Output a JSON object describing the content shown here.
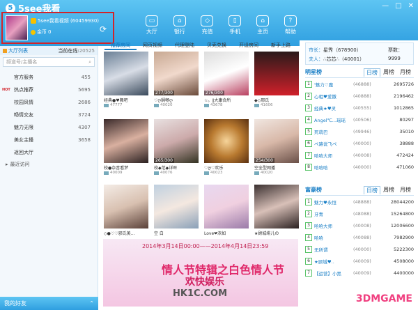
{
  "app": {
    "title": "5see我看"
  },
  "window": {
    "min": "—",
    "max": "□",
    "close": "✕"
  },
  "user": {
    "name": "5see我看视频 (60459930)",
    "coins_label": "金币",
    "coins": "0"
  },
  "nav": [
    {
      "label": "大厅",
      "icon": "hall-icon"
    },
    {
      "label": "银行",
      "icon": "bank-icon"
    },
    {
      "label": "充值",
      "icon": "recharge-icon"
    },
    {
      "label": "手机",
      "icon": "phone-icon"
    },
    {
      "label": "主页",
      "icon": "home-icon"
    },
    {
      "label": "帮助",
      "icon": "help-icon"
    }
  ],
  "sidebar": {
    "list_label": "大厅列表",
    "online_label": "当前在线:",
    "online": "20525",
    "search_placeholder": "频道号/主播名",
    "categories": [
      {
        "label": "官方服务",
        "count": "455",
        "hot": ""
      },
      {
        "label": "热点推荐",
        "count": "5695",
        "hot": "HOT"
      },
      {
        "label": "校园风情",
        "count": "2686",
        "hot": ""
      },
      {
        "label": "畅情交友",
        "count": "3724",
        "hot": ""
      },
      {
        "label": "魅力无限",
        "count": "4307",
        "hot": ""
      },
      {
        "label": "美女主播",
        "count": "3658",
        "hot": ""
      },
      {
        "label": "返回大厅",
        "count": "",
        "hot": ""
      }
    ],
    "recent": "最近访问",
    "friends": "我的好友"
  },
  "tabs": [
    "推荐房间",
    "网页视频",
    "代理登陆",
    "贝壳兑换",
    "开设房间",
    "新手上路"
  ],
  "rooms": [
    {
      "name": "经典●♥舞吧",
      "count": "",
      "views": "47777"
    },
    {
      "name": "♡ღ娴畅ღ",
      "count": "277/300",
      "views": "40020"
    },
    {
      "name": "☆。∥大康合所",
      "count": "276/300",
      "views": "43678"
    },
    {
      "name": "◆◇邢氏",
      "count": "",
      "views": "41606"
    },
    {
      "name": "校●杂音看梦",
      "count": "",
      "views": "40009"
    },
    {
      "name": "校◆范◆详旺",
      "count": "265/300",
      "views": "40076"
    },
    {
      "name": "♡ღ♡欢乐",
      "count": "",
      "views": "40023"
    },
    {
      "name": "空全型网播",
      "count": "254/300",
      "views": "40020"
    },
    {
      "name": "◇●♡♡邪氏美...",
      "count": "",
      "views": ""
    },
    {
      "name": "空 白",
      "count": "",
      "views": ""
    },
    {
      "name": "Love❤浓如",
      "count": "",
      "views": ""
    },
    {
      "name": "★顾城绯儿の",
      "count": "",
      "views": ""
    }
  ],
  "banner": {
    "date": "2014年3月14日00:00——2014年4月14日23:59",
    "title": "情人节特辑之白色情人节",
    "sub": "欢快娱乐",
    "site": "HK1C.COM"
  },
  "info": {
    "market_label": "市长：",
    "market_value": "星秀（678900）",
    "husband_label": "夫人：",
    "husband_value": "∴芯芯∴（40001）",
    "ticket_label": "票数：",
    "ticket_value": "9999"
  },
  "star": {
    "title": "明星榜",
    "tabs": [
      "日榜",
      "周榜",
      "月榜"
    ],
    "rows": [
      {
        "rank": "1",
        "name": "'魅力♡魔",
        "id": "(46888)",
        "score": "2695726"
      },
      {
        "rank": "2",
        "name": "心相♥爱撒",
        "id": "(40888)",
        "score": "2196462"
      },
      {
        "rank": "3",
        "name": "经典★♥灵",
        "id": "(40555)",
        "score": "1012865"
      },
      {
        "rank": "4",
        "name": "Angel℃...瑶瑶",
        "id": "(40506)",
        "score": "80297"
      },
      {
        "rank": "5",
        "name": "死萌巴",
        "id": "(49946)",
        "score": "35010"
      },
      {
        "rank": "6",
        "name": "ぺ路说飞ぺ",
        "id": "(40000)",
        "score": "38888"
      },
      {
        "rank": "7",
        "name": "哈哈大师",
        "id": "(40008)",
        "score": "472424"
      },
      {
        "rank": "8",
        "name": "哈哈哈",
        "id": "(40000)",
        "score": "471060"
      }
    ]
  },
  "rich": {
    "title": "富豪榜",
    "tabs": [
      "日榜",
      "周榜",
      "月榜"
    ],
    "rows": [
      {
        "rank": "1",
        "name": "魅力♥永恒",
        "id": "(48888)",
        "score": "28044200"
      },
      {
        "rank": "2",
        "name": "牙青",
        "id": "(48088)",
        "score": "15264800"
      },
      {
        "rank": "3",
        "name": "哈哈大师",
        "id": "(40008)",
        "score": "12006600"
      },
      {
        "rank": "4",
        "name": "哈哈",
        "id": "(40088)",
        "score": "7982900"
      },
      {
        "rank": "5",
        "name": "无所谓",
        "id": "(40000)",
        "score": "5222300"
      },
      {
        "rank": "6",
        "name": "★顾城♥..",
        "id": "(40009)",
        "score": "4508000"
      },
      {
        "rank": "7",
        "name": "【运营】小黑",
        "id": "(40009)",
        "score": "4400000"
      }
    ]
  },
  "watermark": "3DMGAME"
}
